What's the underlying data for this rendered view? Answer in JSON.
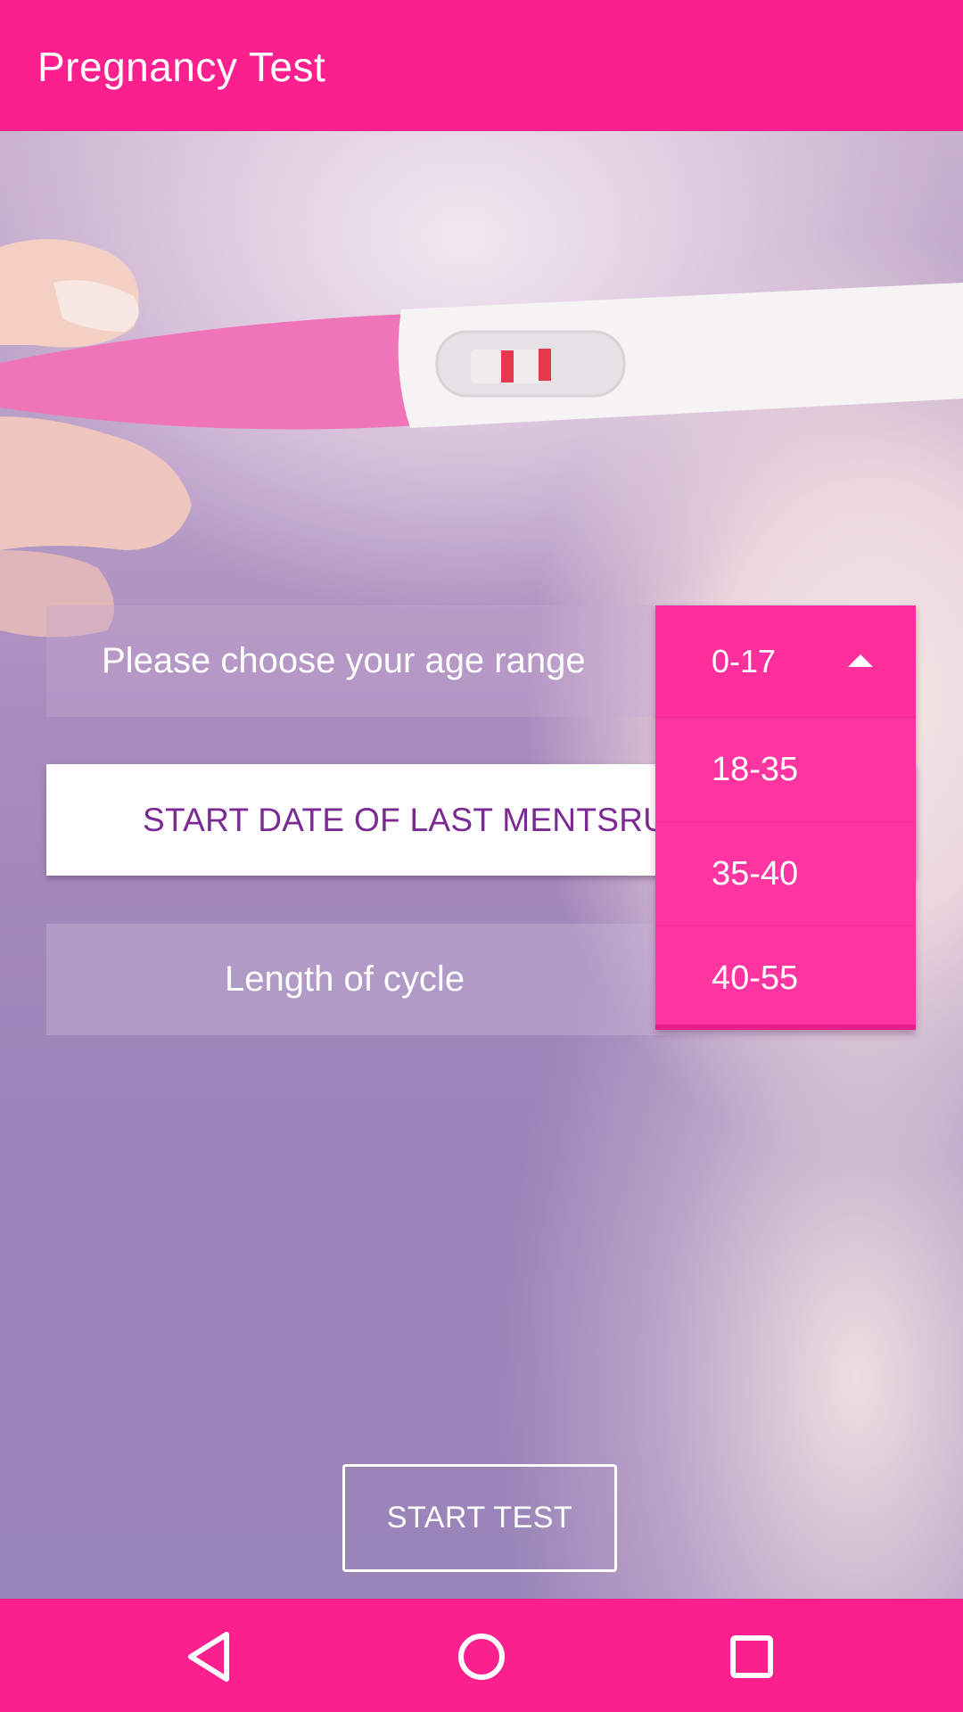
{
  "app_bar": {
    "title": "Pregnancy Test"
  },
  "form": {
    "age_prompt": "Please choose your age range",
    "start_date_button": "START DATE OF LAST MENTSRUATION",
    "cycle_prompt": "Length of cycle"
  },
  "age_dropdown": {
    "selected": "0-17",
    "options": [
      "18-35",
      "35-40",
      "40-55"
    ]
  },
  "start_test_button": "START TEST",
  "colors": {
    "primary": "#fb208d",
    "dropdown": "#fe35a0",
    "date_text": "#7b2a93"
  },
  "nav": {
    "back": "back-icon",
    "home": "home-icon",
    "recent": "recent-apps-icon"
  }
}
